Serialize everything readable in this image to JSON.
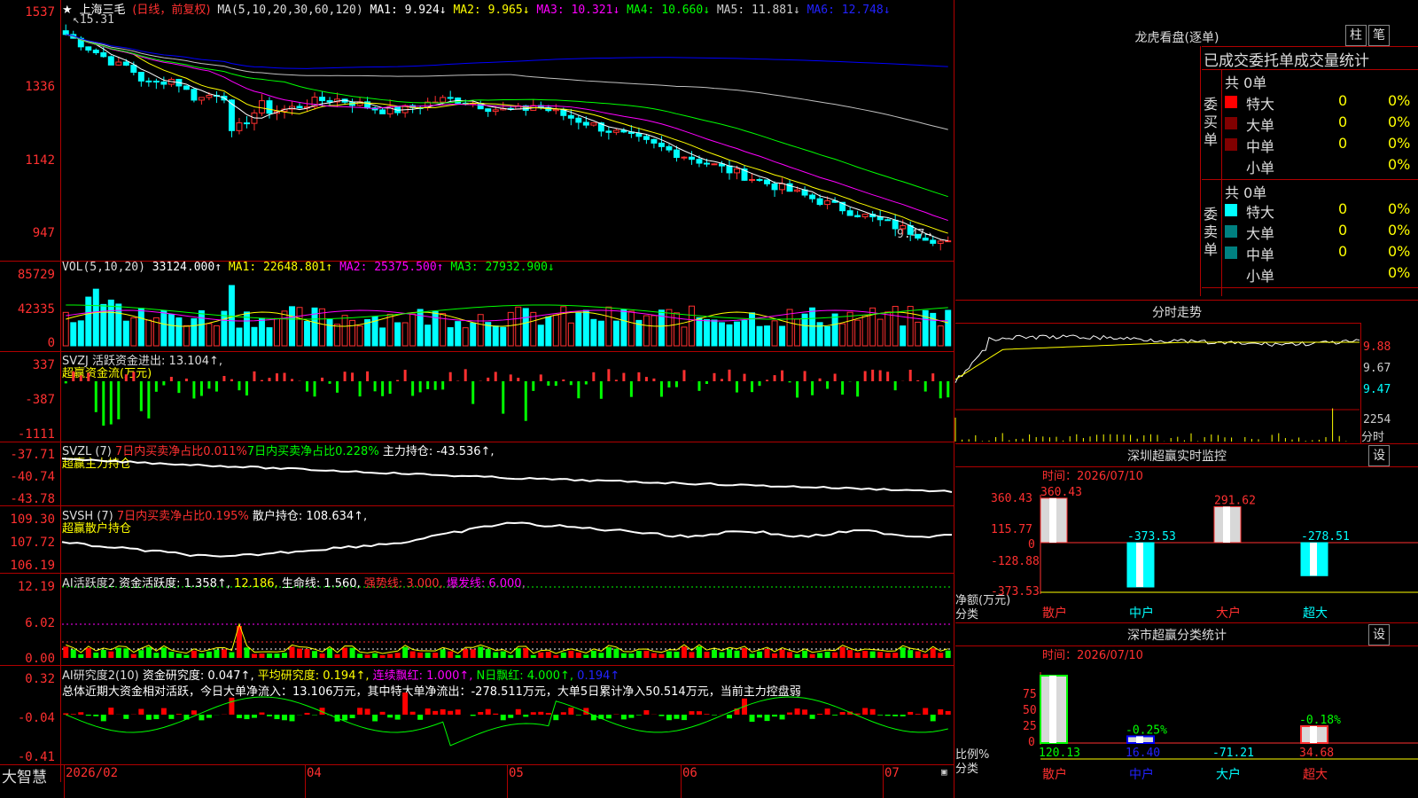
{
  "app": {
    "brand": "大智慧"
  },
  "kline": {
    "stock_name": "上海三毛",
    "period_label": "(日线，前复权)",
    "ma_label": "MA(5,10,20,30,60,120)",
    "ma1": "MA1: 9.924↓",
    "ma2": "MA2: 9.965↓",
    "ma3": "MA3: 10.321↓",
    "ma4": "MA4: 10.660↓",
    "ma5": "MA5: 11.881↓",
    "ma6": "MA6: 12.748↓",
    "high_note": "15.31",
    "low_note": "9.47",
    "y_ticks": [
      "1537",
      "1336",
      "1142",
      "947"
    ],
    "colors": {
      "ma1": "#ffffff",
      "ma2": "#ffff00",
      "ma3": "#ff00ff",
      "ma4": "#00ff00",
      "ma5": "#c0c0c0",
      "ma6": "#0000ff"
    }
  },
  "vol": {
    "label": "VOL(5,10,20)",
    "value": "33124.000↑",
    "ma1": "MA1: 22648.801↑",
    "ma2": "MA2: 25375.500↑",
    "ma3": "MA3: 27932.900↓",
    "y_ticks": [
      "85729",
      "42335",
      "0"
    ]
  },
  "svzj": {
    "label": "SVZJ",
    "line1": "活跃资金进出: 13.104↑,",
    "line2": "超赢资金流(万元)",
    "y_ticks": [
      "337",
      "-387",
      "-1111"
    ]
  },
  "svzl": {
    "label": "SVZL (7)",
    "a": "7日内买卖净占比0.011%",
    "b": "7日内买卖净占比0.228%",
    "c": "主力持仓: -43.536↑,",
    "line2": "超赢主力持仓",
    "y_ticks": [
      "-37.71",
      "-40.74",
      "-43.78"
    ]
  },
  "svsh": {
    "label": "SVSH (7)",
    "a": "7日内买卖净占比0.195%",
    "b": "散户持仓: 108.634↑,",
    "line2": "超赢散户持仓",
    "y_ticks": [
      "109.30",
      "107.72",
      "106.19"
    ]
  },
  "ai1": {
    "label": "AI活跃度2",
    "a": "资金活跃度: 1.358↑,",
    "b": "12.186,",
    "c": "生命线: 1.560,",
    "d": "强势线: 3.000,",
    "e": "爆发线: 6.000,",
    "y_ticks": [
      "12.19",
      "6.02",
      "0.00"
    ]
  },
  "ai2": {
    "label": "AI研究度2(10)",
    "a": "资金研究度: 0.047↑,",
    "b": "平均研究度: 0.194↑,",
    "c": "连续飘红: 1.000↑,",
    "d": "N日飘红: 4.000↑,",
    "e": "0.194↑",
    "summary": "总体近期大资金相对活跃，今日大单净流入：13.106万元，其中特大单净流出：-278.511万元，大单5日累计净入50.514万元，当前主力控盘弱",
    "y_ticks": [
      "0.32",
      "-0.04",
      "-0.41"
    ]
  },
  "xaxis": {
    "labels": [
      "2026/02",
      "04",
      "05",
      "06",
      "07"
    ]
  },
  "longhu": {
    "title": "龙虎看盘(逐单)",
    "btn_zhu": "柱",
    "btn_bi": "笔",
    "header": "已成交委托单成交量统计",
    "buy_side": "委买单",
    "sell_side": "委卖单",
    "buy_total": "共 0单",
    "sell_total": "共 0单",
    "rows": [
      "特大",
      "大单",
      "中单",
      "小单"
    ],
    "buy_counts": [
      "0",
      "0",
      "0",
      ""
    ],
    "buy_pcts": [
      "0%",
      "0%",
      "0%",
      "0%"
    ],
    "sell_counts": [
      "0",
      "0",
      "0",
      ""
    ],
    "sell_pcts": [
      "0%",
      "0%",
      "0%",
      "0%"
    ],
    "buy_colors": [
      "#ff0000",
      "#800000",
      "#800000",
      ""
    ],
    "sell_colors": [
      "#00ffff",
      "#008080",
      "#008080",
      ""
    ]
  },
  "intraday": {
    "title": "分时走势",
    "y_ticks": [
      "9.88",
      "9.67",
      "9.47"
    ],
    "vol_tick": "2254",
    "vol_unit": "分时"
  },
  "sz_monitor": {
    "title": "深圳超赢实时监控",
    "btn": "设",
    "time_label": "时间：2026/07/10",
    "y_ticks": [
      "360.43",
      "115.77",
      "0",
      "-128.88",
      "-373.53"
    ],
    "unit": "净额(万元)",
    "cat_label": "分类",
    "categories": [
      "散户",
      "中户",
      "大户",
      "超大"
    ],
    "values": [
      360.43,
      -373.53,
      291.62,
      -278.51
    ],
    "value_labels": [
      "360.43",
      "-373.53",
      "291.62",
      "-278.51"
    ]
  },
  "sz_class": {
    "title": "深市超赢分类统计",
    "btn": "设",
    "time_label": "时间：2026/07/10",
    "y_ticks": [
      "75",
      "50",
      "25",
      "0"
    ],
    "unit": "比例%",
    "cat_label": "分类",
    "categories": [
      "散户",
      "中户",
      "大户",
      "超大"
    ],
    "bar_pcts": [
      100,
      25,
      0,
      25
    ],
    "bar_notes": [
      "",
      "-0.25%",
      "",
      "-0.18%"
    ],
    "values": [
      "120.13",
      "16.40",
      "-71.21",
      "34.68"
    ]
  }
}
